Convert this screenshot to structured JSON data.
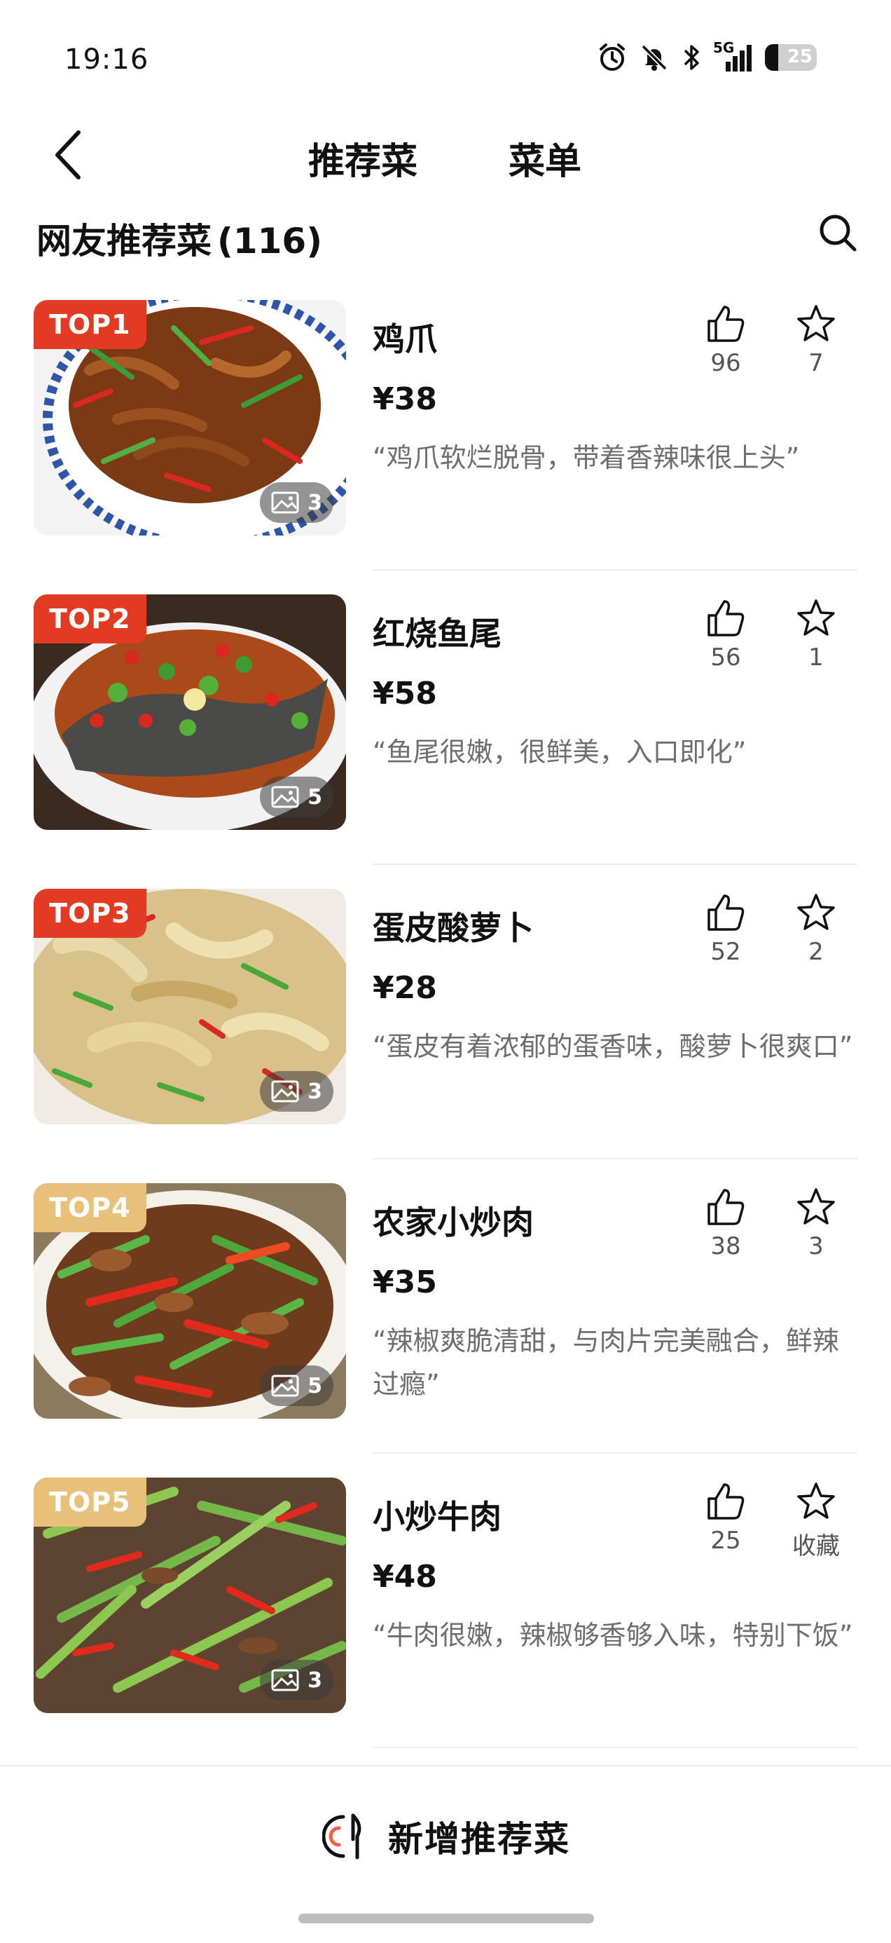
{
  "status_bar": {
    "time": "19:16",
    "network": "5G",
    "battery": "25"
  },
  "header": {
    "tabs": [
      {
        "label": "推荐菜",
        "active": true
      },
      {
        "label": "菜单",
        "active": false
      }
    ]
  },
  "section": {
    "title": "网友推荐菜",
    "count": "(116)"
  },
  "dishes": [
    {
      "rank": "TOP1",
      "name": "鸡爪",
      "price": "¥38",
      "quote": "“鸡爪软烂脱骨，带着香辣味很上头”",
      "likes": "96",
      "favorites": "7",
      "photos": "3"
    },
    {
      "rank": "TOP2",
      "name": "红烧鱼尾",
      "price": "¥58",
      "quote": "“鱼尾很嫩，很鲜美，入口即化”",
      "likes": "56",
      "favorites": "1",
      "photos": "5"
    },
    {
      "rank": "TOP3",
      "name": "蛋皮酸萝卜",
      "price": "¥28",
      "quote": "“蛋皮有着浓郁的蛋香味，酸萝卜很爽口”",
      "likes": "52",
      "favorites": "2",
      "photos": "3"
    },
    {
      "rank": "TOP4",
      "name": "农家小炒肉",
      "price": "¥35",
      "quote": "“辣椒爽脆清甜，与肉片完美融合，鲜辣过瘾”",
      "likes": "38",
      "favorites": "3",
      "photos": "5"
    },
    {
      "rank": "TOP5",
      "name": "小炒牛肉",
      "price": "¥48",
      "quote": "“牛肉很嫩，辣椒够香够入味，特别下饭”",
      "likes": "25",
      "favorites": "收藏",
      "photos": "3"
    }
  ],
  "bottom": {
    "add_label": "新增推荐菜"
  },
  "colors": {
    "accent": "#ff5a3c",
    "rank_hot": "#e33a22",
    "rank_warm": "#e8c07a"
  }
}
